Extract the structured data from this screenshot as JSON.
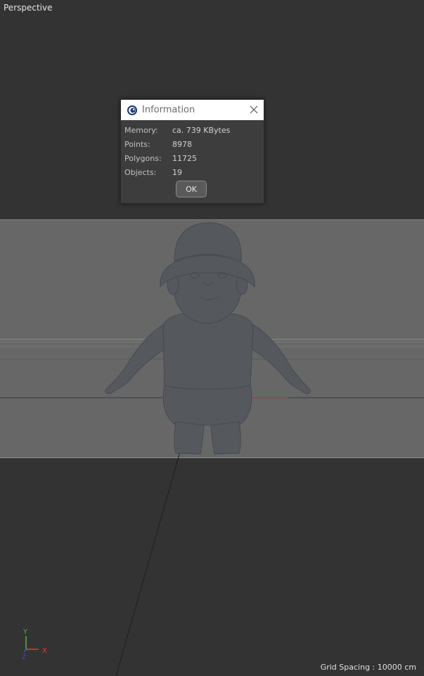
{
  "viewport": {
    "view_name": "Perspective",
    "grid_spacing": "Grid Spacing : 10000 cm"
  },
  "dialog": {
    "title": "Information",
    "rows": [
      {
        "label": "Memory:",
        "value": "ca. 739 KBytes"
      },
      {
        "label": "Points:",
        "value": "8978"
      },
      {
        "label": "Polygons:",
        "value": "11725"
      },
      {
        "label": "Objects:",
        "value": "19"
      }
    ],
    "ok_label": "OK"
  },
  "axis_gizmo": {
    "y_label": "Y",
    "x_label": "X",
    "z_label": "Z",
    "colors": {
      "y": "#4caf50",
      "x": "#e53935",
      "z": "#3f51b5"
    }
  },
  "colors": {
    "viewport_bg": "#333333",
    "scene_band": "#676767",
    "model": "#55595e"
  },
  "icons": [
    "cinema4d-app-icon",
    "close-icon"
  ]
}
